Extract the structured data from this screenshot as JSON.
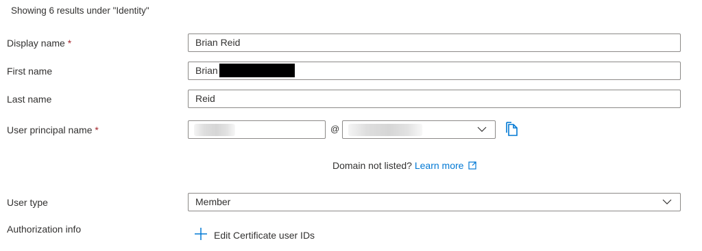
{
  "results_text": "Showing 6 results under \"Identity\"",
  "form": {
    "display_name": {
      "label": "Display name",
      "required_mark": "*",
      "value": "Brian Reid"
    },
    "first_name": {
      "label": "First name",
      "value": "Brian"
    },
    "last_name": {
      "label": "Last name",
      "value": "Reid"
    },
    "user_principal_name": {
      "label": "User principal name",
      "required_mark": "*",
      "at_symbol": "@"
    },
    "domain_note": {
      "text": "Domain not listed?",
      "link": "Learn more"
    },
    "user_type": {
      "label": "User type",
      "value": "Member"
    },
    "authorization": {
      "label": "Authorization info",
      "action": "Edit Certificate user IDs"
    }
  },
  "icons": {
    "copy": "copy-icon",
    "chevron": "chevron-down-icon",
    "external_link": "external-link-icon",
    "add": "plus-icon"
  },
  "colors": {
    "accent": "#0078d4",
    "required": "#a4262c",
    "border": "#8a8886"
  }
}
